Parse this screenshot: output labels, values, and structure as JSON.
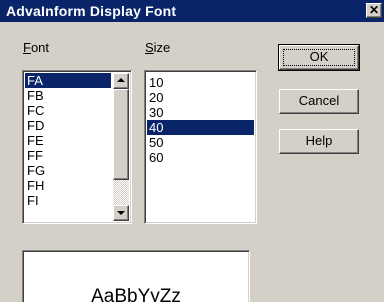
{
  "window": {
    "title": "AdvaInform Display Font",
    "close_glyph": "✕"
  },
  "font_label": {
    "accel": "F",
    "rest": "ont"
  },
  "size_label": {
    "accel": "S",
    "rest": "ize"
  },
  "font_list": {
    "items": [
      "FA",
      "FB",
      "FC",
      "FD",
      "FE",
      "FF",
      "FG",
      "FH",
      "FI"
    ],
    "selected": "FA"
  },
  "size_list": {
    "items": [
      "10",
      "20",
      "30",
      "40",
      "50",
      "60"
    ],
    "selected": "40"
  },
  "buttons": {
    "ok": "OK",
    "cancel": "Cancel",
    "help": "Help"
  },
  "preview": {
    "sample": "AaBbYyZz"
  },
  "colors": {
    "selection": "#0a246a",
    "face": "#d4d0c8",
    "title_bar": "#0a246a"
  }
}
